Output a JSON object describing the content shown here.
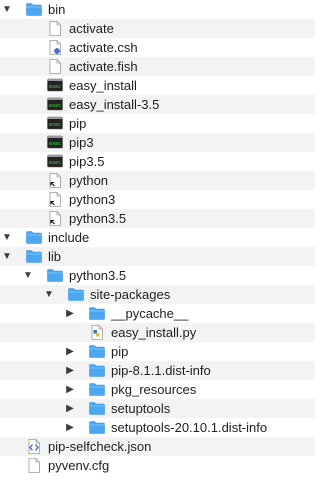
{
  "colors": {
    "folder": "#4aa7f0",
    "folder_tab": "#3b94e2",
    "stripe": "#f3f3f3"
  },
  "tree": [
    {
      "label": "bin",
      "depth": 0,
      "disclosure": "expanded",
      "icon": "folder-icon"
    },
    {
      "label": "activate",
      "depth": 1,
      "disclosure": "none",
      "icon": "document-icon"
    },
    {
      "label": "activate.csh",
      "depth": 1,
      "disclosure": "none",
      "icon": "csh-script-icon"
    },
    {
      "label": "activate.fish",
      "depth": 1,
      "disclosure": "none",
      "icon": "document-icon"
    },
    {
      "label": "easy_install",
      "depth": 1,
      "disclosure": "none",
      "icon": "terminal-exec-icon"
    },
    {
      "label": "easy_install-3.5",
      "depth": 1,
      "disclosure": "none",
      "icon": "terminal-exec-icon"
    },
    {
      "label": "pip",
      "depth": 1,
      "disclosure": "none",
      "icon": "terminal-exec-icon"
    },
    {
      "label": "pip3",
      "depth": 1,
      "disclosure": "none",
      "icon": "terminal-exec-icon"
    },
    {
      "label": "pip3.5",
      "depth": 1,
      "disclosure": "none",
      "icon": "terminal-exec-icon"
    },
    {
      "label": "python",
      "depth": 1,
      "disclosure": "none",
      "icon": "alias-document-icon"
    },
    {
      "label": "python3",
      "depth": 1,
      "disclosure": "none",
      "icon": "alias-document-icon"
    },
    {
      "label": "python3.5",
      "depth": 1,
      "disclosure": "none",
      "icon": "alias-document-icon"
    },
    {
      "label": "include",
      "depth": 0,
      "disclosure": "expanded",
      "icon": "folder-icon"
    },
    {
      "label": "lib",
      "depth": 0,
      "disclosure": "expanded",
      "icon": "folder-icon"
    },
    {
      "label": "python3.5",
      "depth": 1,
      "disclosure": "expanded",
      "icon": "folder-icon"
    },
    {
      "label": "site-packages",
      "depth": 2,
      "disclosure": "expanded",
      "icon": "folder-icon"
    },
    {
      "label": "__pycache__",
      "depth": 3,
      "disclosure": "collapsed",
      "icon": "folder-icon"
    },
    {
      "label": "easy_install.py",
      "depth": 3,
      "disclosure": "none",
      "icon": "python-file-icon"
    },
    {
      "label": "pip",
      "depth": 3,
      "disclosure": "collapsed",
      "icon": "folder-icon"
    },
    {
      "label": "pip-8.1.1.dist-info",
      "depth": 3,
      "disclosure": "collapsed",
      "icon": "folder-icon"
    },
    {
      "label": "pkg_resources",
      "depth": 3,
      "disclosure": "collapsed",
      "icon": "folder-icon"
    },
    {
      "label": "setuptools",
      "depth": 3,
      "disclosure": "collapsed",
      "icon": "folder-icon"
    },
    {
      "label": "setuptools-20.10.1.dist-info",
      "depth": 3,
      "disclosure": "collapsed",
      "icon": "folder-icon"
    },
    {
      "label": "pip-selfcheck.json",
      "depth": 0,
      "disclosure": "none",
      "icon": "json-file-icon"
    },
    {
      "label": "pyvenv.cfg",
      "depth": 0,
      "disclosure": "none",
      "icon": "document-icon"
    }
  ]
}
